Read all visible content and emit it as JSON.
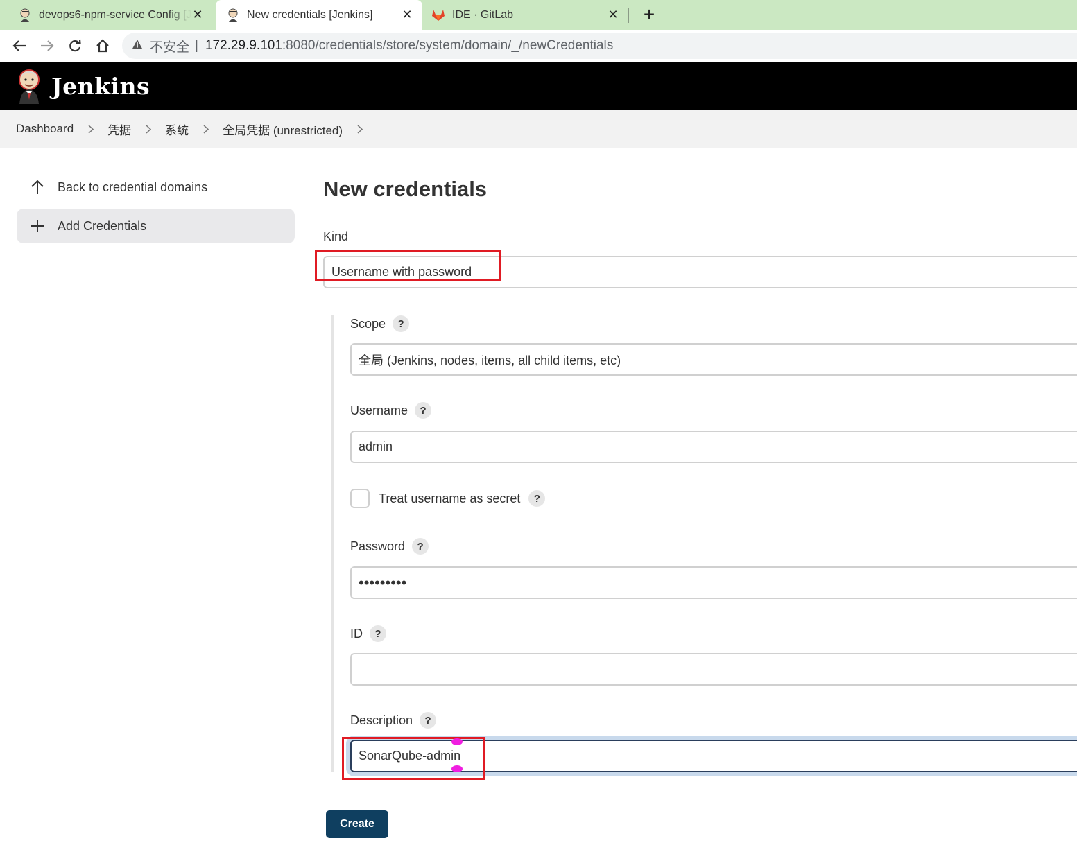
{
  "browser": {
    "tabs": [
      {
        "title": "devops6-npm-service Config [Jenkins]"
      },
      {
        "title": "New credentials [Jenkins]"
      },
      {
        "title": "IDE · GitLab"
      }
    ],
    "address": {
      "security_label": "不安全",
      "host": "172.29.9.101",
      "path": ":8080/credentials/store/system/domain/_/newCredentials"
    }
  },
  "header": {
    "brand": "Jenkins"
  },
  "breadcrumbs": [
    "Dashboard",
    "凭据",
    "系统",
    "全局凭据 (unrestricted)"
  ],
  "sidebar": {
    "items": [
      {
        "label": "Back to credential domains"
      },
      {
        "label": "Add Credentials"
      }
    ]
  },
  "form": {
    "title": "New credentials",
    "kind": {
      "label": "Kind",
      "value": "Username with password"
    },
    "scope": {
      "label": "Scope",
      "value": "全局 (Jenkins, nodes, items, all child items, etc)"
    },
    "username": {
      "label": "Username",
      "value": "admin"
    },
    "treat_secret": {
      "label": "Treat username as secret",
      "checked": false
    },
    "password": {
      "label": "Password",
      "value": "•••••••••"
    },
    "id": {
      "label": "ID",
      "value": ""
    },
    "description": {
      "label": "Description",
      "value": "SonarQube-admin"
    },
    "help_glyph": "?",
    "create_label": "Create"
  },
  "colors": {
    "tabbar": "#cbe8c2",
    "header": "#000000",
    "primary_button": "#0f3f60",
    "highlight_box": "#e01b24"
  }
}
